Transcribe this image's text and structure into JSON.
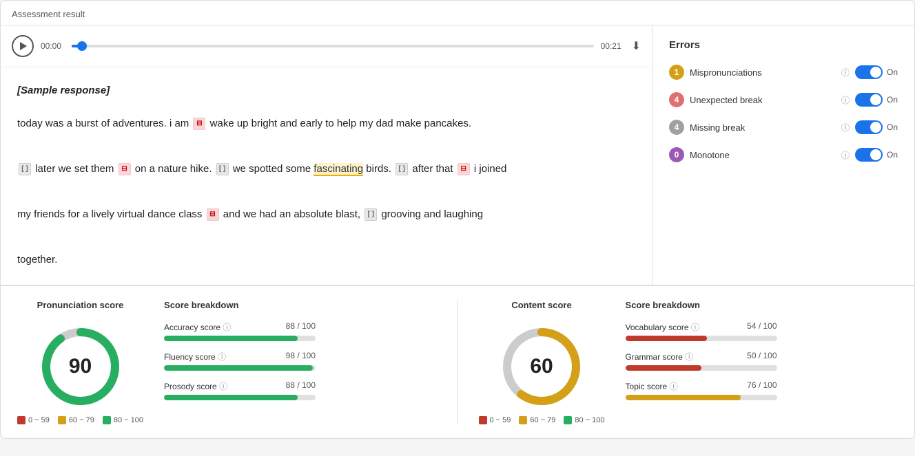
{
  "page": {
    "title": "Assessment result"
  },
  "audio": {
    "time_start": "00:00",
    "time_end": "00:21",
    "progress_percent": 2
  },
  "sample_label": "[Sample response]",
  "text_segments": [
    {
      "type": "text",
      "content": "today was a burst of adventures. i am "
    },
    {
      "type": "break_unexpected",
      "content": "⊟"
    },
    {
      "type": "text",
      "content": " wake up bright and early to help my dad make pancakes."
    },
    {
      "type": "newline"
    },
    {
      "type": "break_missing",
      "content": "[ ]"
    },
    {
      "type": "text",
      "content": " later we set them "
    },
    {
      "type": "break_unexpected",
      "content": "⊟"
    },
    {
      "type": "text",
      "content": " on a nature hike. "
    },
    {
      "type": "break_missing",
      "content": "[ ]"
    },
    {
      "type": "text",
      "content": " we spotted some "
    },
    {
      "type": "highlight",
      "content": "fascinating"
    },
    {
      "type": "text",
      "content": " birds. "
    },
    {
      "type": "break_missing",
      "content": "[ ]"
    },
    {
      "type": "text",
      "content": " after that "
    },
    {
      "type": "break_unexpected",
      "content": "⊟"
    },
    {
      "type": "text",
      "content": " i joined"
    },
    {
      "type": "newline"
    },
    {
      "type": "text",
      "content": "my friends for a lively virtual dance class "
    },
    {
      "type": "break_unexpected",
      "content": "⊟"
    },
    {
      "type": "text",
      "content": " and we had an absolute blast, "
    },
    {
      "type": "break_missing",
      "content": "[ ]"
    },
    {
      "type": "text",
      "content": " grooving and laughing"
    },
    {
      "type": "newline"
    },
    {
      "type": "text",
      "content": "together."
    }
  ],
  "errors": {
    "title": "Errors",
    "items": [
      {
        "badge": "1",
        "badge_class": "badge-yellow",
        "label": "Mispronunciations",
        "toggle_state": "On"
      },
      {
        "badge": "4",
        "badge_class": "badge-pink",
        "label": "Unexpected break",
        "toggle_state": "On"
      },
      {
        "badge": "4",
        "badge_class": "badge-gray",
        "label": "Missing break",
        "toggle_state": "On"
      },
      {
        "badge": "0",
        "badge_class": "badge-purple",
        "label": "Monotone",
        "toggle_state": "On"
      }
    ]
  },
  "pronunciation": {
    "title": "Pronunciation score",
    "score": "90",
    "donut": {
      "green_pct": 90,
      "gray_pct": 10,
      "color_green": "#27ae60",
      "color_gray": "#ccc"
    },
    "legend": [
      {
        "label": "0 ~ 59",
        "color": "dot-red"
      },
      {
        "label": "60 ~ 79",
        "color": "dot-yellow"
      },
      {
        "label": "80 ~ 100",
        "color": "dot-green"
      }
    ],
    "breakdown_title": "Score breakdown",
    "breakdown": [
      {
        "label": "Accuracy score",
        "value": "88 / 100",
        "pct": 88,
        "bar": "bar-fill-green"
      },
      {
        "label": "Fluency score",
        "value": "98 / 100",
        "pct": 98,
        "bar": "bar-fill-green"
      },
      {
        "label": "Prosody score",
        "value": "88 / 100",
        "pct": 88,
        "bar": "bar-fill-green"
      }
    ]
  },
  "content": {
    "title": "Content score",
    "score": "60",
    "donut": {
      "yellow_pct": 60,
      "gray_pct": 40,
      "color_yellow": "#d4a017",
      "color_gray": "#ccc"
    },
    "legend": [
      {
        "label": "0 ~ 59",
        "color": "dot-red"
      },
      {
        "label": "60 ~ 79",
        "color": "dot-yellow"
      },
      {
        "label": "80 ~ 100",
        "color": "dot-green"
      }
    ],
    "breakdown_title": "Score breakdown",
    "breakdown": [
      {
        "label": "Vocabulary score",
        "value": "54 / 100",
        "pct": 54,
        "bar": "bar-fill-red"
      },
      {
        "label": "Grammar score",
        "value": "50 / 100",
        "pct": 50,
        "bar": "bar-fill-red"
      },
      {
        "label": "Topic score",
        "value": "76 / 100",
        "pct": 76,
        "bar": "bar-fill-yellow"
      }
    ]
  }
}
